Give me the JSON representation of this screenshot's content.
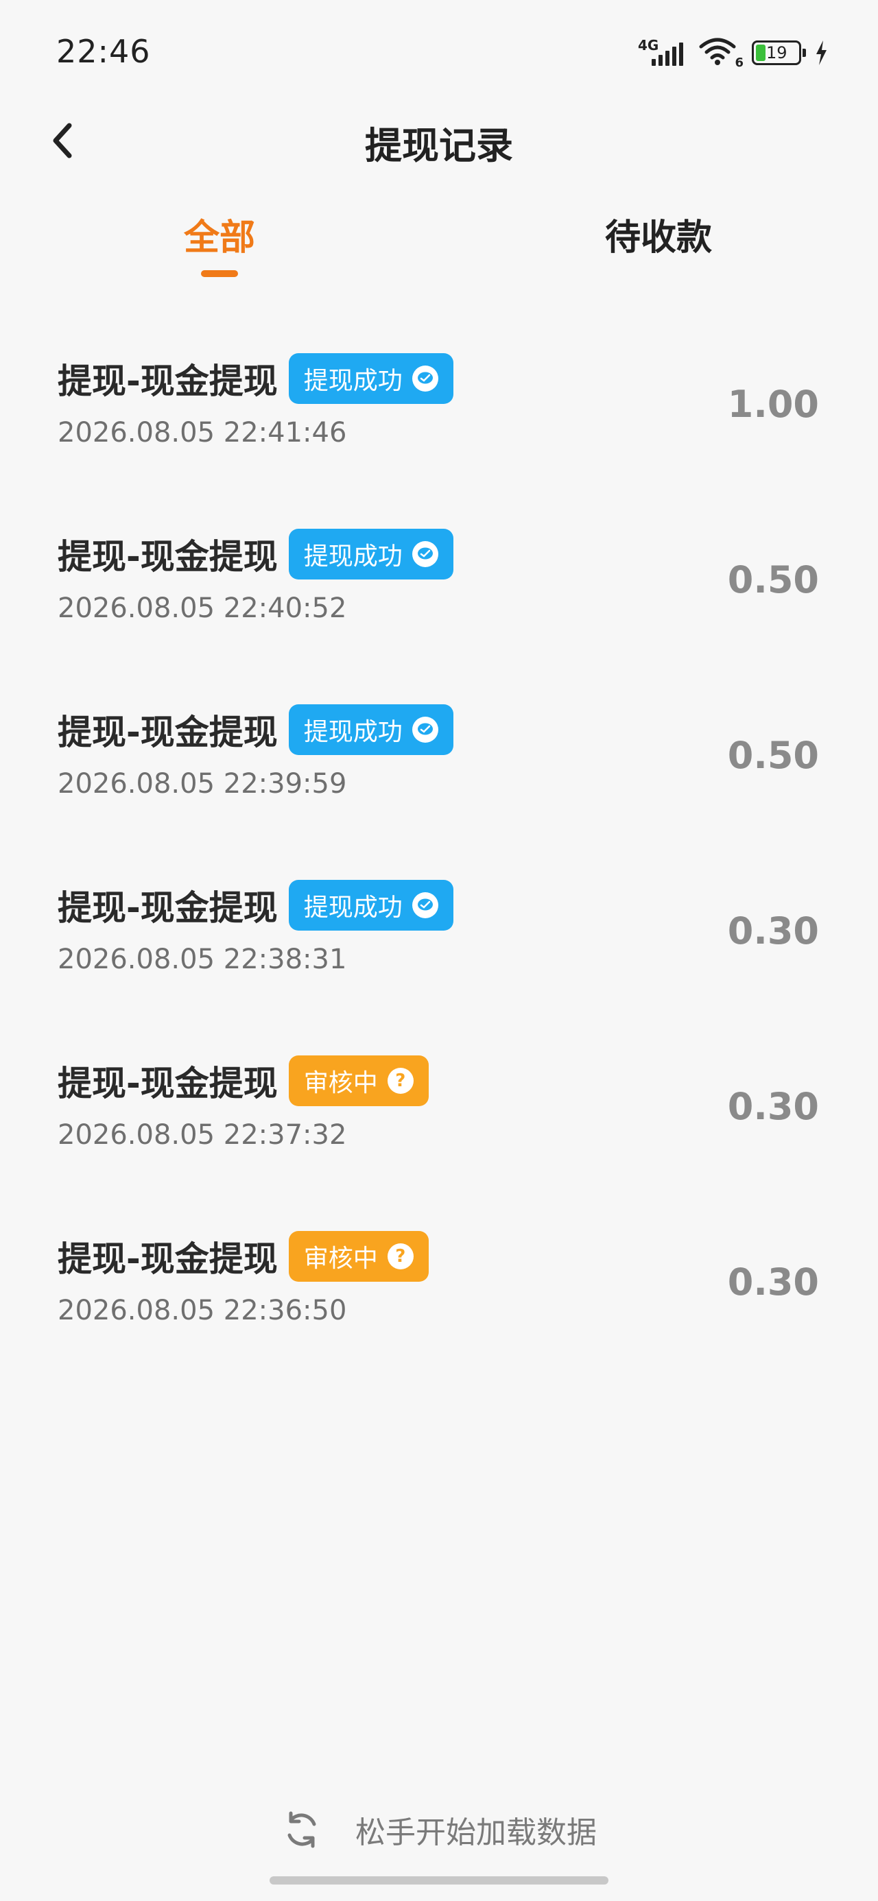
{
  "status_bar": {
    "time": "22:46",
    "network": "4G",
    "wifi_badge": "6",
    "battery": "19",
    "icons": [
      "signal-icon",
      "wifi-icon",
      "battery-icon",
      "charging-icon"
    ]
  },
  "header": {
    "title": "提现记录",
    "back_icon": "chevron-left-icon"
  },
  "tabs": [
    {
      "label": "全部",
      "active": true
    },
    {
      "label": "待收款",
      "active": false
    }
  ],
  "colors": {
    "accent": "#f07a18",
    "success_badge": "#1fa9f2",
    "review_badge": "#f9a41f",
    "amount": "#8a8a8a"
  },
  "records": [
    {
      "title": "提现-现金提现",
      "status": "提现成功",
      "status_type": "success",
      "status_icon": "wechat-icon",
      "time": "2026.08.05 22:41:46",
      "amount": "1.00"
    },
    {
      "title": "提现-现金提现",
      "status": "提现成功",
      "status_type": "success",
      "status_icon": "wechat-icon",
      "time": "2026.08.05 22:40:52",
      "amount": "0.50"
    },
    {
      "title": "提现-现金提现",
      "status": "提现成功",
      "status_type": "success",
      "status_icon": "wechat-icon",
      "time": "2026.08.05 22:39:59",
      "amount": "0.50"
    },
    {
      "title": "提现-现金提现",
      "status": "提现成功",
      "status_type": "success",
      "status_icon": "wechat-icon",
      "time": "2026.08.05 22:38:31",
      "amount": "0.30"
    },
    {
      "title": "提现-现金提现",
      "status": "审核中",
      "status_type": "review",
      "status_icon": "question-icon",
      "question_mark": "?",
      "time": "2026.08.05 22:37:32",
      "amount": "0.30"
    },
    {
      "title": "提现-现金提现",
      "status": "审核中",
      "status_type": "review",
      "status_icon": "question-icon",
      "question_mark": "?",
      "time": "2026.08.05 22:36:50",
      "amount": "0.30"
    }
  ],
  "footer": {
    "load_text": "松手开始加载数据",
    "icon": "refresh-icon"
  }
}
